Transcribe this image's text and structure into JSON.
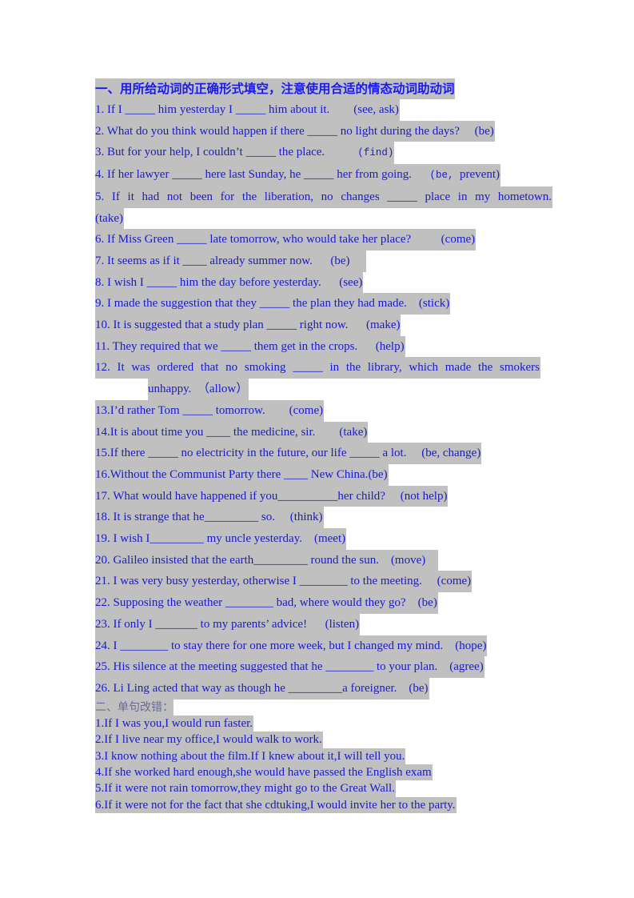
{
  "section1": {
    "title": "一、用所给动词的正确形式填空，注意使用合适的情态动词助动词",
    "items": [
      "1. If I _____ him yesterday I _____ him about it.        (see, ask)",
      "2. What do you think would happen if there _____ no light during the days?     (be)",
      "3. But for your help, I couldn’t _____ the place.",
      "4. If her lawyer _____ here last Sunday, he _____ her from going.",
      "5. If it had not been for the liberation, no changes _____ place in my hometown.",
      "6. If Miss Green _____ late tomorrow, who would take her place?          (come)",
      "7. It seems as if it ____ already summer now.      (be)",
      "8. I wish I _____ him the day before yesterday.      (see)",
      "9. I made the suggestion that they _____ the plan they had made.    (stick)",
      "10. It is suggested that a study plan _____ right now.      (make)",
      "11. They required that we _____ them get in the crops.      (help)",
      "12. It was ordered that no smoking _____ in the library, which made the smokers",
      "13.I’d rather Tom _____ tomorrow.        (come)",
      "14.It is about time you ____ the medicine, sir.        (take)",
      "15.If there _____ no electricity in the future, our life _____ a lot.     (be, change)",
      "16.Without the Communist Party there ____ New China.(be)",
      "17. What would have happened if you__________her child?     (not help)",
      "18. It is strange that he_________ so.     (think)",
      "19. I wish I_________ my uncle yesterday.    (meet)",
      "20. Galileo insisted that the earth_________ round the sun.    (move)",
      "21. I was very busy yesterday, otherwise I ________ to the meeting.     (come)",
      "22. Supposing the weather ________ bad, where would they go?    (be)",
      "23. If only I _______ to my parents’ advice!      (listen)",
      "24. I ________ to stay there for one more week, but I changed my mind.    (hope)",
      "25. His silence at the meeting suggested that he ________ to your plan.    (agree)",
      "26. Li Ling acted that way as though he _________a foreigner.    (be)"
    ],
    "hints": {
      "item3": "(find)",
      "item4_a": "(be, ",
      "item4_b": "prevent)",
      "item5": "(take)",
      "item12": "unhappy.  （allow）"
    }
  },
  "section2": {
    "title": "二、单句改错：",
    "items": [
      "1.If I was you,I would run faster.",
      "2.If I live near my office,I would walk to work.",
      "3.I know nothing about the film.If I knew about it,I will tell you.",
      "4.If she worked hard enough,she would have passed the English exam",
      "5.If it were not rain tomorrow,they might go to the Great Wall.",
      "6.If it were not for the fact that she cdtuking,I would invite her to the party."
    ]
  }
}
